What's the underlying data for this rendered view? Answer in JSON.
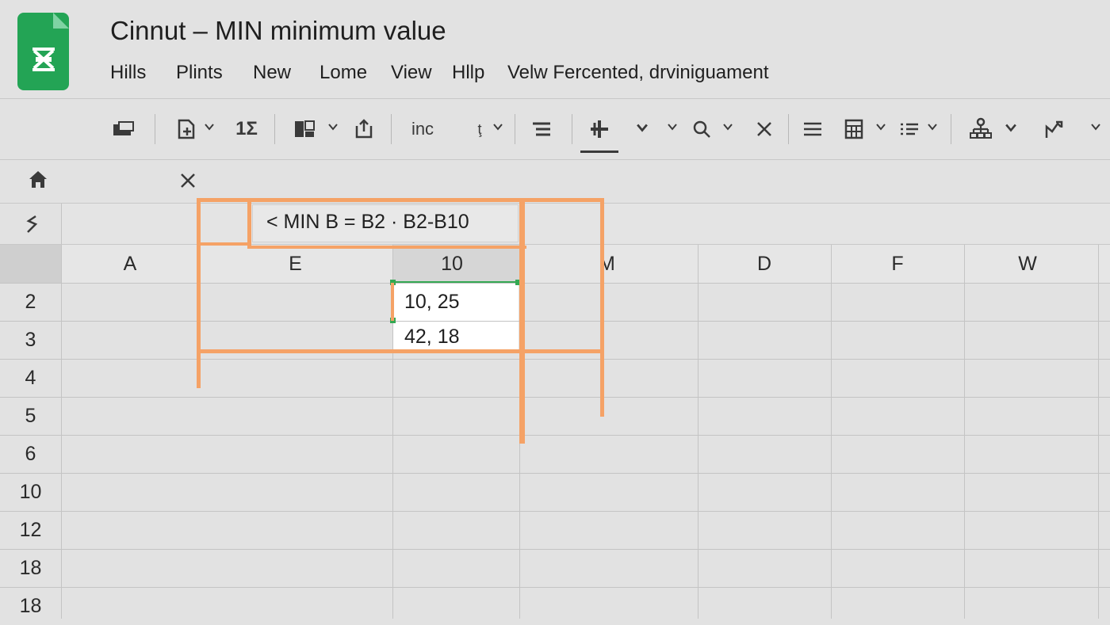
{
  "app": {
    "title": "Cinnut – MIN minimum value",
    "brand_color": "#23a455",
    "accent_color": "#f5a266",
    "selection_color": "#34a853"
  },
  "menu": {
    "items": [
      "Hills",
      "Plints",
      "New",
      "Lome",
      "View",
      "Hllp",
      "Velw Fercented, drviniguament"
    ]
  },
  "toolbar": {
    "labels": [
      "1Σ",
      "inc",
      "ţ"
    ],
    "icons": [
      "comment-icon",
      "insert-doc-icon",
      "format-icon",
      "image-icon",
      "export-icon",
      "text-style-icon",
      "align-icon",
      "add-icon",
      "chevron-down-icon",
      "search-icon",
      "close-icon",
      "menu-icon",
      "calculator-icon",
      "list-icon",
      "hierarchy-icon",
      "chart-icon"
    ]
  },
  "namebox": {
    "home_icon": "home-icon",
    "close_icon": "close-icon"
  },
  "formula": {
    "icon": "function-icon",
    "text": "< MIN B =  B2 · B2-B10"
  },
  "grid": {
    "columns": [
      "A",
      "E",
      "10",
      "M",
      "D",
      "F",
      "W"
    ],
    "rows": [
      "2",
      "3",
      "4",
      "5",
      "6",
      "10",
      "12",
      "18",
      "18"
    ],
    "cells": [
      {
        "row": "2",
        "column": "10",
        "value": "10, 25"
      },
      {
        "row": "3",
        "column": "10",
        "value": "42, 18"
      }
    ]
  }
}
